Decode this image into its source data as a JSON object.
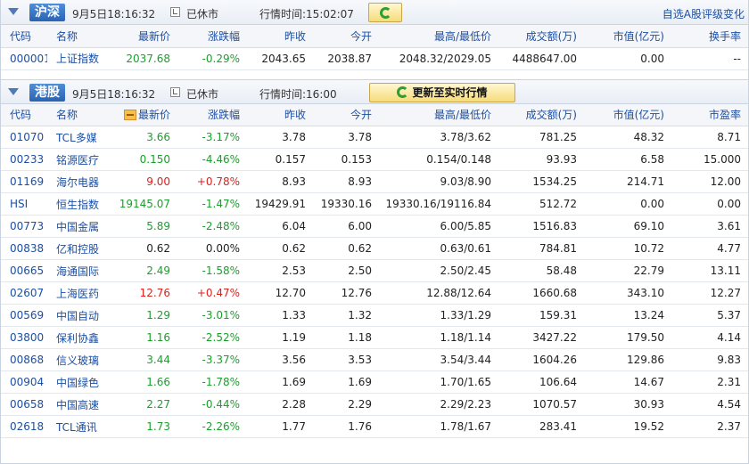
{
  "colors": {
    "up": "#e0201b",
    "down": "#1aa12b",
    "link": "#1c4fa3",
    "tag": "#2a62b4"
  },
  "sh": {
    "tag": "沪深",
    "date": "9月5日18:16:32",
    "status": "已休市",
    "quote_time": "行情时间:15:02:07",
    "refresh_icon": "refresh-icon",
    "rate_link": "自选A股评级变化",
    "headers": [
      "代码",
      "名称",
      "最新价",
      "涨跌幅",
      "昨收",
      "今开",
      "最高/最低价",
      "成交额(万)",
      "市值(亿元)",
      "换手率"
    ],
    "rows": [
      {
        "code": "000001",
        "name": "上证指数",
        "price": "2037.68",
        "change": "-0.29%",
        "prev": "2043.65",
        "open": "2038.87",
        "hl": "2048.32/2029.05",
        "amount": "4488647.00",
        "mktcap": "0.00",
        "last": "--",
        "dir": "down"
      }
    ]
  },
  "hk": {
    "tag": "港股",
    "date": "9月5日18:16:32",
    "status": "已休市",
    "quote_time": "行情时间:16:00",
    "refresh_label": "更新至实时行情",
    "refresh_icon": "refresh-icon",
    "headers": [
      "代码",
      "名称",
      "最新价",
      "涨跌幅",
      "昨收",
      "今开",
      "最高/最低价",
      "成交额(万)",
      "市值(亿元)",
      "市盈率"
    ],
    "rows": [
      {
        "code": "01070",
        "name": "TCL多媒",
        "price": "3.66",
        "change": "-3.17%",
        "prev": "3.78",
        "open": "3.78",
        "hl": "3.78/3.62",
        "amount": "781.25",
        "mktcap": "48.32",
        "last": "8.71",
        "dir": "down"
      },
      {
        "code": "00233",
        "name": "铭源医疗",
        "price": "0.150",
        "change": "-4.46%",
        "prev": "0.157",
        "open": "0.153",
        "hl": "0.154/0.148",
        "amount": "93.93",
        "mktcap": "6.58",
        "last": "15.000",
        "dir": "down"
      },
      {
        "code": "01169",
        "name": "海尔电器",
        "price": "9.00",
        "change": "+0.78%",
        "prev": "8.93",
        "open": "8.93",
        "hl": "9.03/8.90",
        "amount": "1534.25",
        "mktcap": "214.71",
        "last": "12.00",
        "dir": "up"
      },
      {
        "code": "HSI",
        "name": "恒生指数",
        "price": "19145.07",
        "change": "-1.47%",
        "prev": "19429.91",
        "open": "19330.16",
        "hl": "19330.16/19116.84",
        "amount": "512.72",
        "mktcap": "0.00",
        "last": "0.00",
        "dir": "down"
      },
      {
        "code": "00773",
        "name": "中国金属",
        "price": "5.89",
        "change": "-2.48%",
        "prev": "6.04",
        "open": "6.00",
        "hl": "6.00/5.85",
        "amount": "1516.83",
        "mktcap": "69.10",
        "last": "3.61",
        "dir": "down"
      },
      {
        "code": "00838",
        "name": "亿和控股",
        "price": "0.62",
        "change": "0.00%",
        "prev": "0.62",
        "open": "0.62",
        "hl": "0.63/0.61",
        "amount": "784.81",
        "mktcap": "10.72",
        "last": "4.77",
        "dir": "flat"
      },
      {
        "code": "00665",
        "name": "海通国际",
        "price": "2.49",
        "change": "-1.58%",
        "prev": "2.53",
        "open": "2.50",
        "hl": "2.50/2.45",
        "amount": "58.48",
        "mktcap": "22.79",
        "last": "13.11",
        "dir": "down"
      },
      {
        "code": "02607",
        "name": "上海医药",
        "price": "12.76",
        "change": "+0.47%",
        "prev": "12.70",
        "open": "12.76",
        "hl": "12.88/12.64",
        "amount": "1660.68",
        "mktcap": "343.10",
        "last": "12.27",
        "dir": "up"
      },
      {
        "code": "00569",
        "name": "中国自动",
        "price": "1.29",
        "change": "-3.01%",
        "prev": "1.33",
        "open": "1.32",
        "hl": "1.33/1.29",
        "amount": "159.31",
        "mktcap": "13.24",
        "last": "5.37",
        "dir": "down"
      },
      {
        "code": "03800",
        "name": "保利协鑫",
        "price": "1.16",
        "change": "-2.52%",
        "prev": "1.19",
        "open": "1.18",
        "hl": "1.18/1.14",
        "amount": "3427.22",
        "mktcap": "179.50",
        "last": "4.14",
        "dir": "down"
      },
      {
        "code": "00868",
        "name": "信义玻璃",
        "price": "3.44",
        "change": "-3.37%",
        "prev": "3.56",
        "open": "3.53",
        "hl": "3.54/3.44",
        "amount": "1604.26",
        "mktcap": "129.86",
        "last": "9.83",
        "dir": "down"
      },
      {
        "code": "00904",
        "name": "中国绿色",
        "price": "1.66",
        "change": "-1.78%",
        "prev": "1.69",
        "open": "1.69",
        "hl": "1.70/1.65",
        "amount": "106.64",
        "mktcap": "14.67",
        "last": "2.31",
        "dir": "down"
      },
      {
        "code": "00658",
        "name": "中国高速",
        "price": "2.27",
        "change": "-0.44%",
        "prev": "2.28",
        "open": "2.29",
        "hl": "2.29/2.23",
        "amount": "1070.57",
        "mktcap": "30.93",
        "last": "4.54",
        "dir": "down"
      },
      {
        "code": "02618",
        "name": "TCL通讯",
        "price": "1.73",
        "change": "-2.26%",
        "prev": "1.77",
        "open": "1.76",
        "hl": "1.78/1.67",
        "amount": "283.41",
        "mktcap": "19.52",
        "last": "2.37",
        "dir": "down"
      }
    ]
  }
}
